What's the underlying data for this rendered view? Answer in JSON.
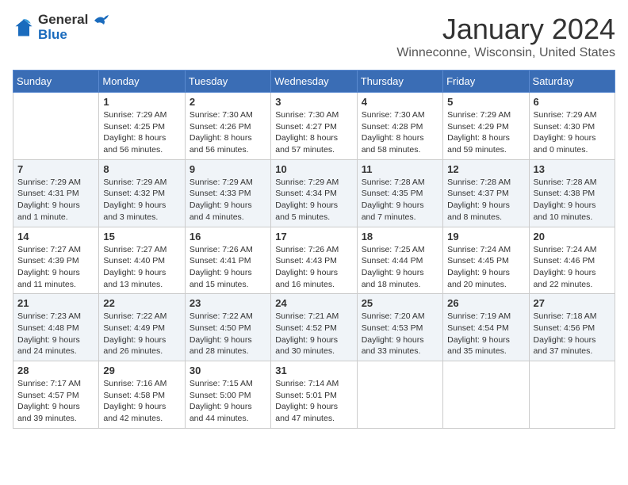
{
  "header": {
    "logo_general": "General",
    "logo_blue": "Blue",
    "month_title": "January 2024",
    "location": "Winneconne, Wisconsin, United States"
  },
  "calendar": {
    "days_of_week": [
      "Sunday",
      "Monday",
      "Tuesday",
      "Wednesday",
      "Thursday",
      "Friday",
      "Saturday"
    ],
    "weeks": [
      [
        {
          "day": "",
          "info": ""
        },
        {
          "day": "1",
          "info": "Sunrise: 7:29 AM\nSunset: 4:25 PM\nDaylight: 8 hours\nand 56 minutes."
        },
        {
          "day": "2",
          "info": "Sunrise: 7:30 AM\nSunset: 4:26 PM\nDaylight: 8 hours\nand 56 minutes."
        },
        {
          "day": "3",
          "info": "Sunrise: 7:30 AM\nSunset: 4:27 PM\nDaylight: 8 hours\nand 57 minutes."
        },
        {
          "day": "4",
          "info": "Sunrise: 7:30 AM\nSunset: 4:28 PM\nDaylight: 8 hours\nand 58 minutes."
        },
        {
          "day": "5",
          "info": "Sunrise: 7:29 AM\nSunset: 4:29 PM\nDaylight: 8 hours\nand 59 minutes."
        },
        {
          "day": "6",
          "info": "Sunrise: 7:29 AM\nSunset: 4:30 PM\nDaylight: 9 hours\nand 0 minutes."
        }
      ],
      [
        {
          "day": "7",
          "info": "Sunrise: 7:29 AM\nSunset: 4:31 PM\nDaylight: 9 hours\nand 1 minute."
        },
        {
          "day": "8",
          "info": "Sunrise: 7:29 AM\nSunset: 4:32 PM\nDaylight: 9 hours\nand 3 minutes."
        },
        {
          "day": "9",
          "info": "Sunrise: 7:29 AM\nSunset: 4:33 PM\nDaylight: 9 hours\nand 4 minutes."
        },
        {
          "day": "10",
          "info": "Sunrise: 7:29 AM\nSunset: 4:34 PM\nDaylight: 9 hours\nand 5 minutes."
        },
        {
          "day": "11",
          "info": "Sunrise: 7:28 AM\nSunset: 4:35 PM\nDaylight: 9 hours\nand 7 minutes."
        },
        {
          "day": "12",
          "info": "Sunrise: 7:28 AM\nSunset: 4:37 PM\nDaylight: 9 hours\nand 8 minutes."
        },
        {
          "day": "13",
          "info": "Sunrise: 7:28 AM\nSunset: 4:38 PM\nDaylight: 9 hours\nand 10 minutes."
        }
      ],
      [
        {
          "day": "14",
          "info": "Sunrise: 7:27 AM\nSunset: 4:39 PM\nDaylight: 9 hours\nand 11 minutes."
        },
        {
          "day": "15",
          "info": "Sunrise: 7:27 AM\nSunset: 4:40 PM\nDaylight: 9 hours\nand 13 minutes."
        },
        {
          "day": "16",
          "info": "Sunrise: 7:26 AM\nSunset: 4:41 PM\nDaylight: 9 hours\nand 15 minutes."
        },
        {
          "day": "17",
          "info": "Sunrise: 7:26 AM\nSunset: 4:43 PM\nDaylight: 9 hours\nand 16 minutes."
        },
        {
          "day": "18",
          "info": "Sunrise: 7:25 AM\nSunset: 4:44 PM\nDaylight: 9 hours\nand 18 minutes."
        },
        {
          "day": "19",
          "info": "Sunrise: 7:24 AM\nSunset: 4:45 PM\nDaylight: 9 hours\nand 20 minutes."
        },
        {
          "day": "20",
          "info": "Sunrise: 7:24 AM\nSunset: 4:46 PM\nDaylight: 9 hours\nand 22 minutes."
        }
      ],
      [
        {
          "day": "21",
          "info": "Sunrise: 7:23 AM\nSunset: 4:48 PM\nDaylight: 9 hours\nand 24 minutes."
        },
        {
          "day": "22",
          "info": "Sunrise: 7:22 AM\nSunset: 4:49 PM\nDaylight: 9 hours\nand 26 minutes."
        },
        {
          "day": "23",
          "info": "Sunrise: 7:22 AM\nSunset: 4:50 PM\nDaylight: 9 hours\nand 28 minutes."
        },
        {
          "day": "24",
          "info": "Sunrise: 7:21 AM\nSunset: 4:52 PM\nDaylight: 9 hours\nand 30 minutes."
        },
        {
          "day": "25",
          "info": "Sunrise: 7:20 AM\nSunset: 4:53 PM\nDaylight: 9 hours\nand 33 minutes."
        },
        {
          "day": "26",
          "info": "Sunrise: 7:19 AM\nSunset: 4:54 PM\nDaylight: 9 hours\nand 35 minutes."
        },
        {
          "day": "27",
          "info": "Sunrise: 7:18 AM\nSunset: 4:56 PM\nDaylight: 9 hours\nand 37 minutes."
        }
      ],
      [
        {
          "day": "28",
          "info": "Sunrise: 7:17 AM\nSunset: 4:57 PM\nDaylight: 9 hours\nand 39 minutes."
        },
        {
          "day": "29",
          "info": "Sunrise: 7:16 AM\nSunset: 4:58 PM\nDaylight: 9 hours\nand 42 minutes."
        },
        {
          "day": "30",
          "info": "Sunrise: 7:15 AM\nSunset: 5:00 PM\nDaylight: 9 hours\nand 44 minutes."
        },
        {
          "day": "31",
          "info": "Sunrise: 7:14 AM\nSunset: 5:01 PM\nDaylight: 9 hours\nand 47 minutes."
        },
        {
          "day": "",
          "info": ""
        },
        {
          "day": "",
          "info": ""
        },
        {
          "day": "",
          "info": ""
        }
      ]
    ]
  }
}
